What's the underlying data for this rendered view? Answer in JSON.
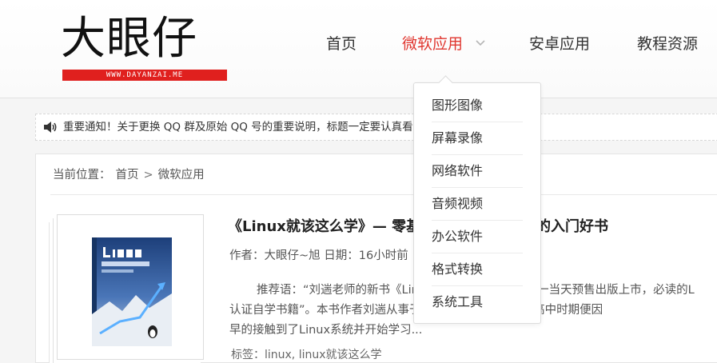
{
  "logo": {
    "text": "大眼仔",
    "subtitle": "WWW.DAYANZAI.ME"
  },
  "nav": {
    "items": [
      "首页",
      "微软应用",
      "安卓应用",
      "教程资源"
    ],
    "active": "微软应用"
  },
  "dropdown": {
    "items": [
      "图形图像",
      "屏幕录像",
      "网络软件",
      "音频视频",
      "办公软件",
      "格式转换",
      "系统工具"
    ]
  },
  "notice": {
    "text": "重要通知！关于更换 QQ 群及原始 QQ 号的重要说明，标题一定要认真看"
  },
  "breadcrumb": {
    "label": "当前位置：",
    "home": "首页",
    "sep": ">",
    "current": "微软应用"
  },
  "article": {
    "title": "《Linux就该这么学》— 零基础Linux技术学习的入门好书",
    "meta": "作者：大眼仔~旭 日期：16小时前",
    "excerpt_lines": [
      "推荐语：“刘遄老师的新书《Linux就该这么学》在双十一当天预售出版上市，必读的L",
      "认证自学书籍”。本书作者刘遄从事于Linux运维技术行业，高中时期便因",
      "早的接触到了Linux系统并开始学习..."
    ],
    "tags": "标签：linux, linux就该这么学"
  },
  "colors": {
    "accent": "#e0362f",
    "logo_bar": "#e0201e"
  }
}
